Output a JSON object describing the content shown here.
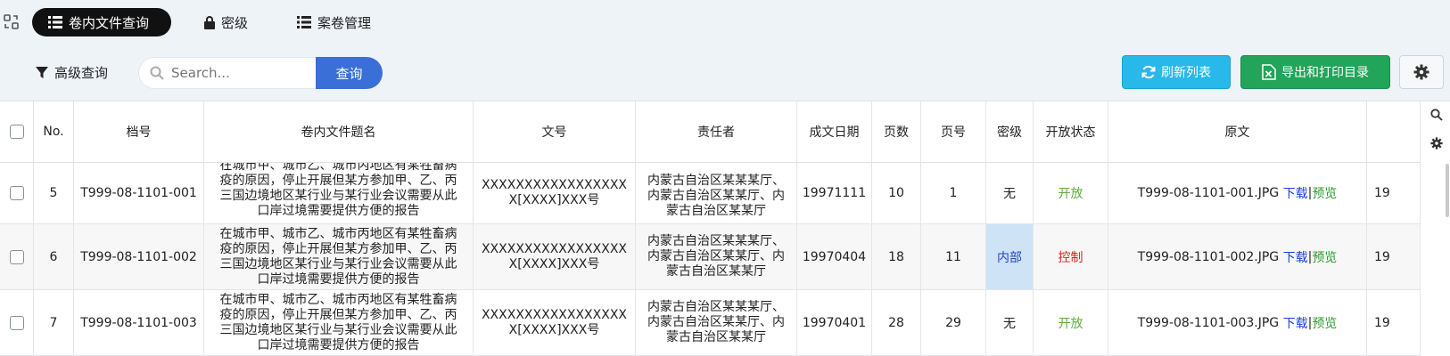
{
  "nav": {
    "app_icon": "grid-switch-icon",
    "tabs": [
      {
        "label": "卷内文件查询",
        "icon": "list-icon",
        "active": true
      },
      {
        "label": "密级",
        "icon": "lock-icon",
        "active": false
      },
      {
        "label": "案卷管理",
        "icon": "list-icon",
        "active": false
      }
    ]
  },
  "toolbar": {
    "advanced_label": "高级查询",
    "search_placeholder": "Search...",
    "search_button": "查询",
    "refresh_label": "刷新列表",
    "export_label": "导出和打印目录",
    "settings_icon": "gear-icon"
  },
  "colors": {
    "active_tab": "#111111",
    "search_btn": "#3a6fd8",
    "refresh_btn": "#29b8ea",
    "export_btn": "#22a45a",
    "secret_highlight": "#cfe3f7"
  },
  "table": {
    "headers": [
      "No.",
      "档号",
      "卷内文件题名",
      "文号",
      "责任者",
      "成文日期",
      "页数",
      "页号",
      "密级",
      "开放状态",
      "原文"
    ],
    "rows": [
      {
        "no": "5",
        "code": "T999-08-1101-001",
        "title": "在城市甲、城市乙、城市丙地区有某牲畜病疫的原因，停止开展但某方参加甲、乙、丙三国边境地区某行业与某行业会议需要从此口岸过境需要提供方便的报告",
        "wenhao": "XXXXXXXXXXXXXXXXXX[XXXX]XXX号",
        "resp": "内蒙古自治区某某某厅、内蒙古自治区某某厅、内蒙古自治区某某厅",
        "date": "19971111",
        "pages": "10",
        "page_no": "1",
        "secret": "无",
        "status": "开放",
        "file": "T999-08-1101-001.JPG",
        "dl": "下载",
        "sep": "|",
        "pv": "预览",
        "extra": "19"
      },
      {
        "no": "6",
        "code": "T999-08-1101-002",
        "title": "在城市甲、城市乙、城市丙地区有某牲畜病疫的原因，停止开展但某方参加甲、乙、丙三国边境地区某行业与某行业会议需要从此口岸过境需要提供方便的报告",
        "wenhao": "XXXXXXXXXXXXXXXXXX[XXXX]XXX号",
        "resp": "内蒙古自治区某某某厅、内蒙古自治区某某厅、内蒙古自治区某某厅",
        "date": "19970404",
        "pages": "18",
        "page_no": "11",
        "secret": "内部",
        "status": "控制",
        "file": "T999-08-1101-002.JPG",
        "dl": "下载",
        "sep": "|",
        "pv": "预览",
        "extra": "19"
      },
      {
        "no": "7",
        "code": "T999-08-1101-003",
        "title": "在城市甲、城市乙、城市丙地区有某牲畜病疫的原因，停止开展但某方参加甲、乙、丙三国边境地区某行业与某行业会议需要从此口岸过境需要提供方便的报告",
        "wenhao": "XXXXXXXXXXXXXXXXXX[XXXX]XXX号",
        "resp": "内蒙古自治区某某某厅、内蒙古自治区某某厅、内蒙古自治区某某厅",
        "date": "19970401",
        "pages": "28",
        "page_no": "29",
        "secret": "无",
        "status": "开放",
        "file": "T999-08-1101-003.JPG",
        "dl": "下载",
        "sep": "|",
        "pv": "预览",
        "extra": "19"
      }
    ],
    "side_icons": [
      "search-icon",
      "gear-icon"
    ]
  }
}
